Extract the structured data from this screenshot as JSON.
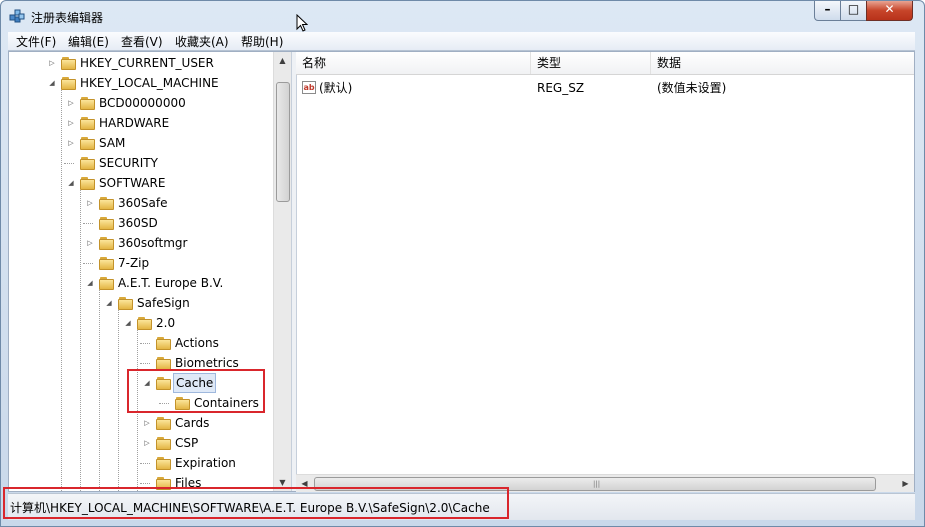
{
  "window": {
    "title": "注册表编辑器",
    "min": "–",
    "max": "□",
    "close": "✕"
  },
  "menu": [
    "文件(F)",
    "编辑(E)",
    "查看(V)",
    "收藏夹(A)",
    "帮助(H)"
  ],
  "tree": [
    {
      "label": "HKEY_CURRENT_USER",
      "expander": "collapsed"
    },
    {
      "label": "HKEY_LOCAL_MACHINE",
      "expander": "expanded"
    },
    {
      "label": "BCD00000000",
      "expander": "collapsed"
    },
    {
      "label": "HARDWARE",
      "expander": "collapsed"
    },
    {
      "label": "SAM",
      "expander": "collapsed"
    },
    {
      "label": "SECURITY",
      "expander": "none"
    },
    {
      "label": "SOFTWARE",
      "expander": "expanded"
    },
    {
      "label": "360Safe",
      "expander": "collapsed"
    },
    {
      "label": "360SD",
      "expander": "none"
    },
    {
      "label": "360softmgr",
      "expander": "collapsed"
    },
    {
      "label": "7-Zip",
      "expander": "none"
    },
    {
      "label": "A.E.T. Europe B.V.",
      "expander": "expanded"
    },
    {
      "label": "SafeSign",
      "expander": "expanded"
    },
    {
      "label": "2.0",
      "expander": "expanded"
    },
    {
      "label": "Actions",
      "expander": "none"
    },
    {
      "label": "Biometrics",
      "expander": "none"
    },
    {
      "label": "Cache",
      "expander": "expanded",
      "selected": true
    },
    {
      "label": "Containers",
      "expander": "none"
    },
    {
      "label": "Cards",
      "expander": "collapsed"
    },
    {
      "label": "CSP",
      "expander": "collapsed"
    },
    {
      "label": "Expiration",
      "expander": "none"
    },
    {
      "label": "Files",
      "expander": "none"
    }
  ],
  "list": {
    "columns": [
      "名称",
      "类型",
      "数据"
    ],
    "rows": [
      {
        "name": "(默认)",
        "type": "REG_SZ",
        "data": "(数值未设置)",
        "icon": "string-value-icon"
      }
    ]
  },
  "status": {
    "path": "计算机\\HKEY_LOCAL_MACHINE\\SOFTWARE\\A.E.T. Europe B.V.\\SafeSign\\2.0\\Cache"
  },
  "highlight_color": "#d9262c"
}
